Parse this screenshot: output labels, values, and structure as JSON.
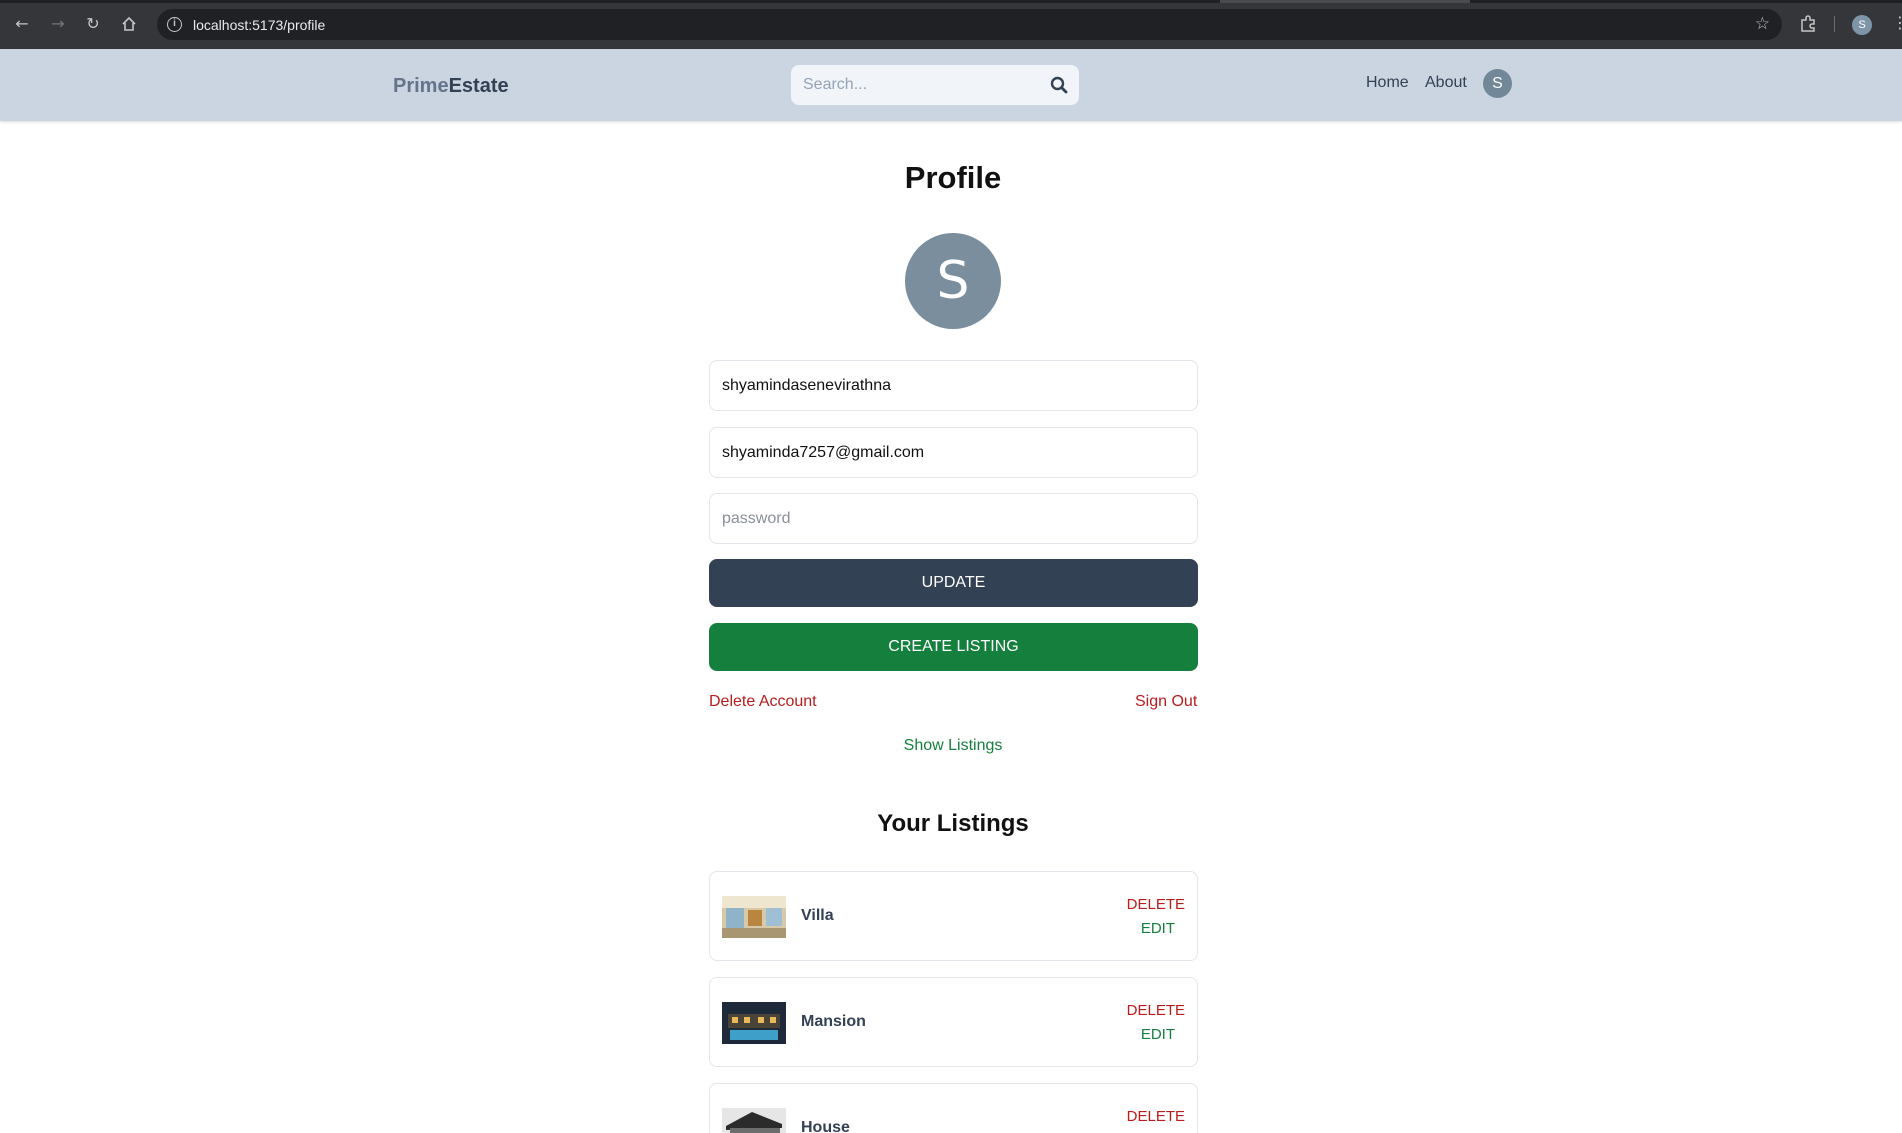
{
  "browser": {
    "url": "localhost:5173/profile",
    "profile_initial": "S"
  },
  "header": {
    "logo_part1": "Prime",
    "logo_part2": "Estate",
    "search_placeholder": "Search...",
    "nav": [
      "Home",
      "About"
    ],
    "avatar_initial": "S"
  },
  "profile": {
    "title": "Profile",
    "avatar_initial": "S",
    "username": "shyamindasenevirathna",
    "email": "shyaminda7257@gmail.com",
    "password_placeholder": "password",
    "update_label": "UPDATE",
    "create_label": "CREATE LISTING",
    "delete_account": "Delete Account",
    "sign_out": "Sign Out",
    "show_listings": "Show Listings"
  },
  "listings": {
    "title": "Your Listings",
    "delete_label": "DELETE",
    "edit_label": "EDIT",
    "items": [
      {
        "name": "Villa"
      },
      {
        "name": "Mansion"
      },
      {
        "name": "House"
      }
    ]
  },
  "colors": {
    "header_bg": "#cbd5e1",
    "update_button": "#334155",
    "create_button": "#15803d",
    "danger": "#b91c1c",
    "success": "#15803d"
  },
  "icons": {
    "search": "search-icon",
    "back": "back-arrow-icon",
    "forward": "forward-arrow-icon",
    "reload": "reload-icon",
    "home": "home-icon",
    "bookmark": "star-icon",
    "extensions": "puzzle-icon",
    "menu": "kebab-menu-icon"
  }
}
